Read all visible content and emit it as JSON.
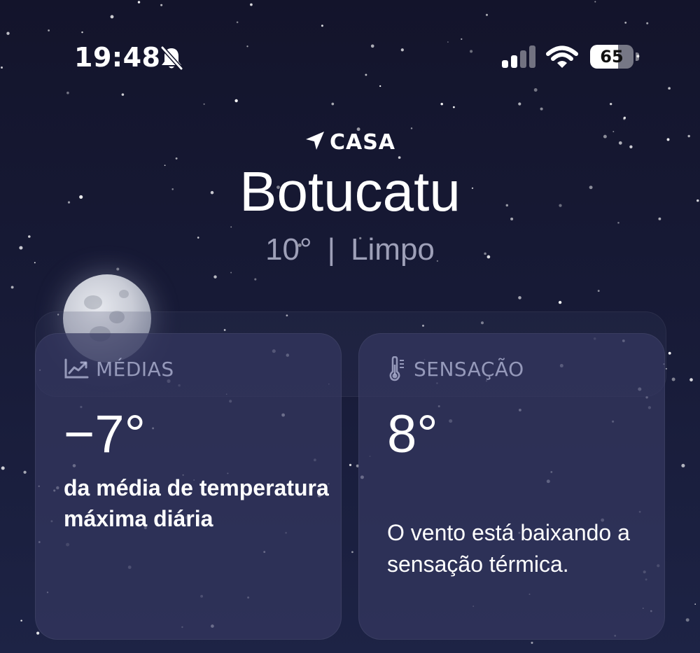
{
  "status_bar": {
    "time": "19:48",
    "battery_level": "65",
    "icons": [
      "bell-muted-icon",
      "signal-icon",
      "wifi-icon",
      "battery-icon"
    ]
  },
  "location": {
    "label": "CASA",
    "city": "Botucatu",
    "temperature": "10°",
    "separator": "|",
    "condition": "Limpo"
  },
  "cards": {
    "averages": {
      "title": "MÉDIAS",
      "icon": "chart-trend-icon",
      "value": "−7°",
      "description": "da média de temperatura máxima diária"
    },
    "feels_like": {
      "title": "SENSAÇÃO",
      "icon": "thermometer-icon",
      "value": "8°",
      "description": "O vento está baixando a sensação térmica."
    }
  },
  "colors": {
    "background_top": "#13142b",
    "background_bottom": "#1d2345",
    "card": "#343860",
    "muted_text": "#bec2e1"
  }
}
